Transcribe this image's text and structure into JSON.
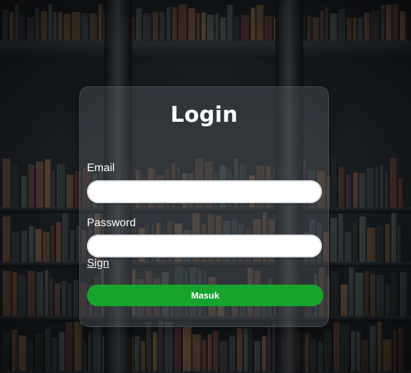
{
  "login": {
    "title": "Login",
    "email_label": "Email",
    "email_value": "",
    "password_label": "Password",
    "password_value": "",
    "sign_link": "Sign",
    "submit_label": "Masuk"
  },
  "colors": {
    "submit_button": "#16a32d",
    "card_background": "rgba(80,86,92,0.42)",
    "text": "#ffffff"
  }
}
